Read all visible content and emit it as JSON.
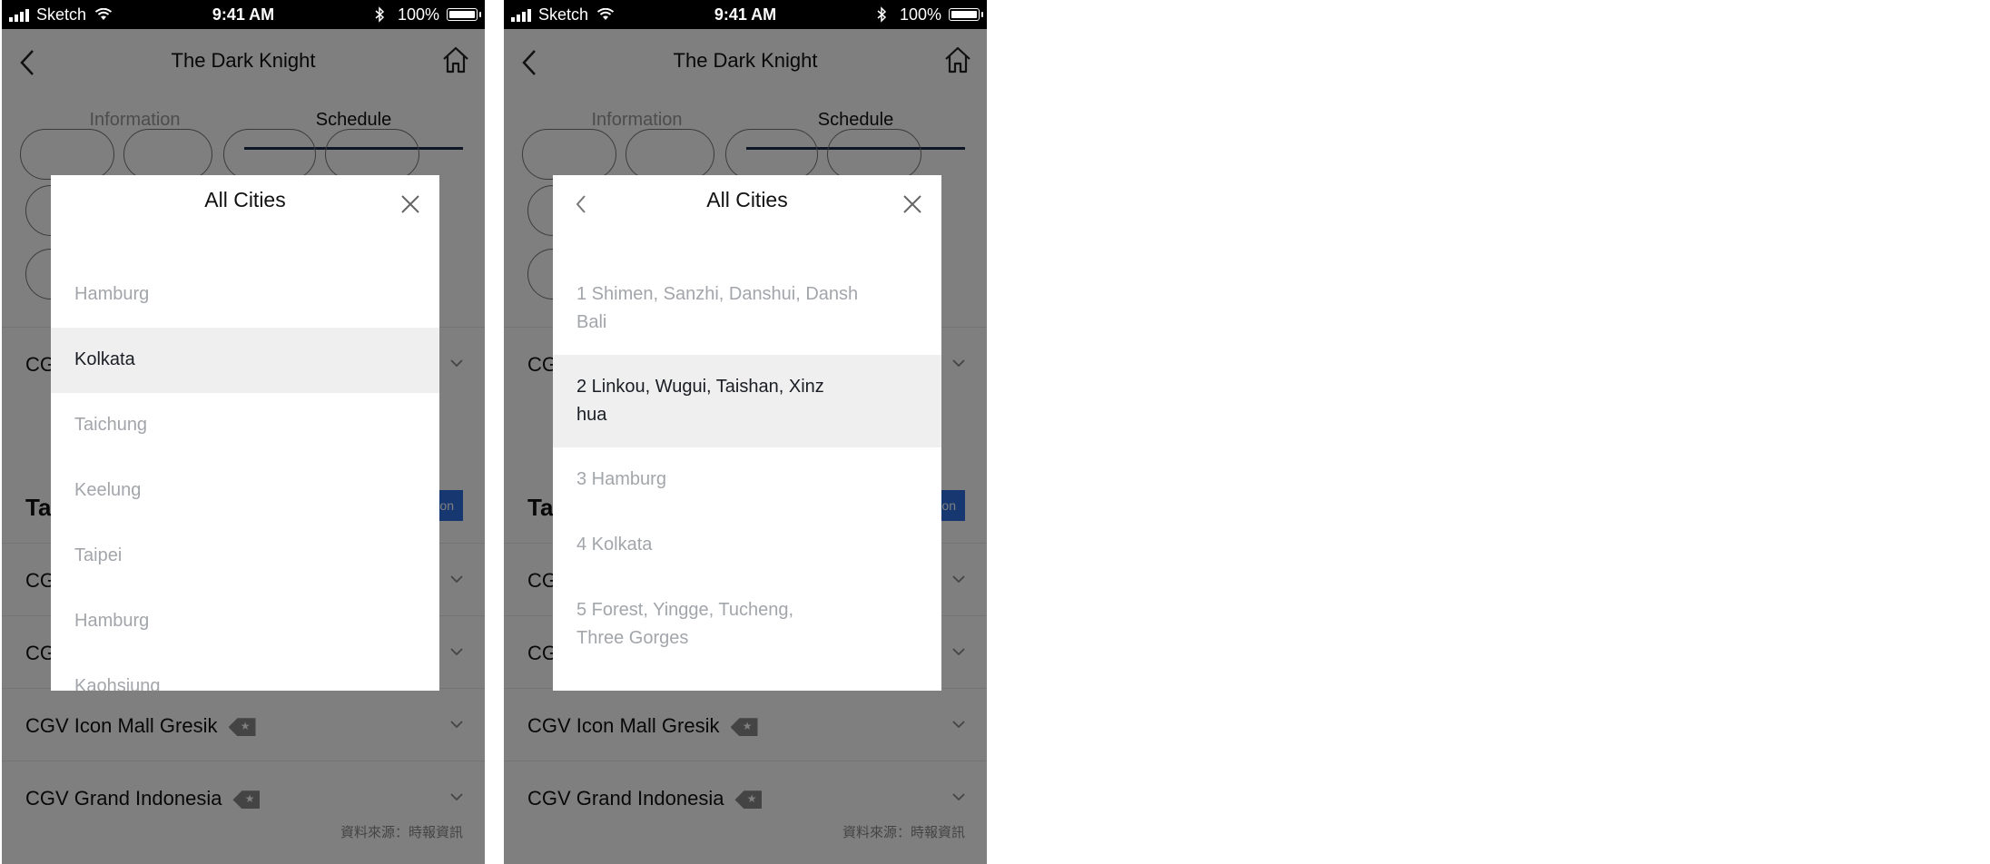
{
  "status_bar": {
    "carrier": "Sketch",
    "time": "9:41 AM",
    "battery": "100%"
  },
  "nav": {
    "title": "The Dark Knight"
  },
  "tabs": [
    {
      "label": "Information",
      "active": false
    },
    {
      "label": "Schedule",
      "active": true
    }
  ],
  "theater_rows": [
    {
      "name": "CG"
    },
    {
      "name": "CG"
    },
    {
      "name": "CG"
    },
    {
      "name": "CGV Icon Mall Gresik",
      "badge": "★"
    },
    {
      "name": "CGV Grand Indonesia",
      "badge": "★"
    }
  ],
  "section": {
    "heading": "Ta",
    "button_text": "on"
  },
  "source_note": "資料來源：時報資訊",
  "modal_left": {
    "title": "All Cities",
    "items": [
      {
        "label": "Hamburg",
        "selected": false
      },
      {
        "label": "Kolkata",
        "selected": true
      },
      {
        "label": "Taichung",
        "selected": false
      },
      {
        "label": "Keelung",
        "selected": false
      },
      {
        "label": "Taipei",
        "selected": false
      },
      {
        "label": "Hamburg",
        "selected": false
      },
      {
        "label": "Kaohsiung",
        "selected": false
      }
    ]
  },
  "modal_right": {
    "title": "All Cities",
    "items": [
      {
        "line1": "1  Shimen, Sanzhi, Danshui, Dansh",
        "line2": "Bali",
        "selected": false
      },
      {
        "line1": "2  Linkou, Wugui, Taishan, Xinz",
        "line2": "hua",
        "selected": true
      },
      {
        "line1": "3 Hamburg",
        "line2": "",
        "selected": false
      },
      {
        "line1": "4 Kolkata",
        "line2": "",
        "selected": false
      },
      {
        "line1": "5  Forest, Yingge, Tucheng,",
        "line2": "Three Gorges",
        "selected": false
      }
    ]
  },
  "colors": {
    "overlay": "#00000080",
    "tab_indicator": "#1c2b4a",
    "selected_row": "#efefef",
    "accent_button": "#2f6fe0"
  }
}
